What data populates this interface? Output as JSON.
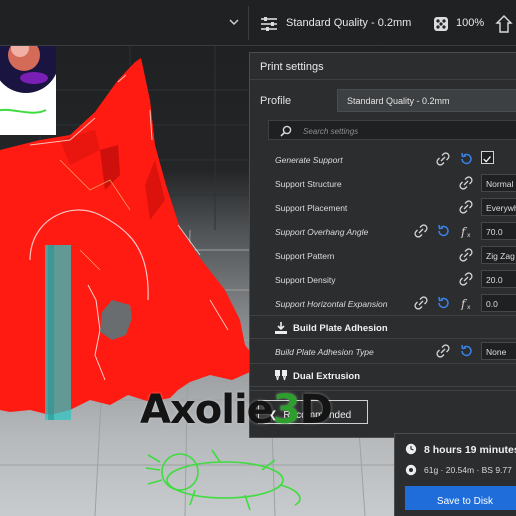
{
  "topbar": {
    "print_profile": "Standard Quality - 0.2mm",
    "infill": "100%"
  },
  "logo": {
    "text": "3D"
  },
  "print_settings": {
    "title": "Print settings",
    "profile_label": "Profile",
    "profile_value": "Standard Quality - 0.2mm",
    "search_placeholder": "Search settings",
    "rows": [
      {
        "label": "Generate Support",
        "italic": true,
        "value_checked": true
      },
      {
        "label": "Support Structure",
        "italic": false,
        "value": "Normal"
      },
      {
        "label": "Support Placement",
        "italic": false,
        "value": "Everywhere"
      },
      {
        "label": "Support Overhang Angle",
        "italic": true,
        "value": "70.0"
      },
      {
        "label": "Support Pattern",
        "italic": false,
        "value": "Zig Zag"
      },
      {
        "label": "Support Density",
        "italic": false,
        "value": "20.0"
      },
      {
        "label": "Support Horizontal Expansion",
        "italic": true,
        "value": "0.0"
      }
    ],
    "sections": {
      "build_plate_adhesion": "Build Plate Adhesion",
      "dual_extrusion": "Dual Extrusion"
    },
    "adhesion_row": {
      "label": "Build Plate Adhesion Type",
      "value": "None"
    },
    "recommended_button": "Recommended"
  },
  "watermark": {
    "text_main": "Axolie",
    "text_accent": "3",
    "text_end": "D"
  },
  "estimate": {
    "time": "8 hours 19 minutes",
    "material": "61g · 20.54m · BS 9.77",
    "save_button": "Save to Disk"
  },
  "colors": {
    "model": "#ff1a12",
    "support": "#2ec4c0",
    "accent_blue": "#1e6ddb",
    "reset_icon": "#3a82e6",
    "logo_green": "#2e9e2e"
  },
  "icons": [
    "chevron-down-icon",
    "sliders-icon",
    "infill-icon",
    "support-icon",
    "search-icon",
    "link-icon",
    "reset-icon",
    "function-icon",
    "adhesion-icon",
    "dual-extrusion-icon",
    "clock-icon",
    "spool-icon",
    "axolotl-icon"
  ]
}
